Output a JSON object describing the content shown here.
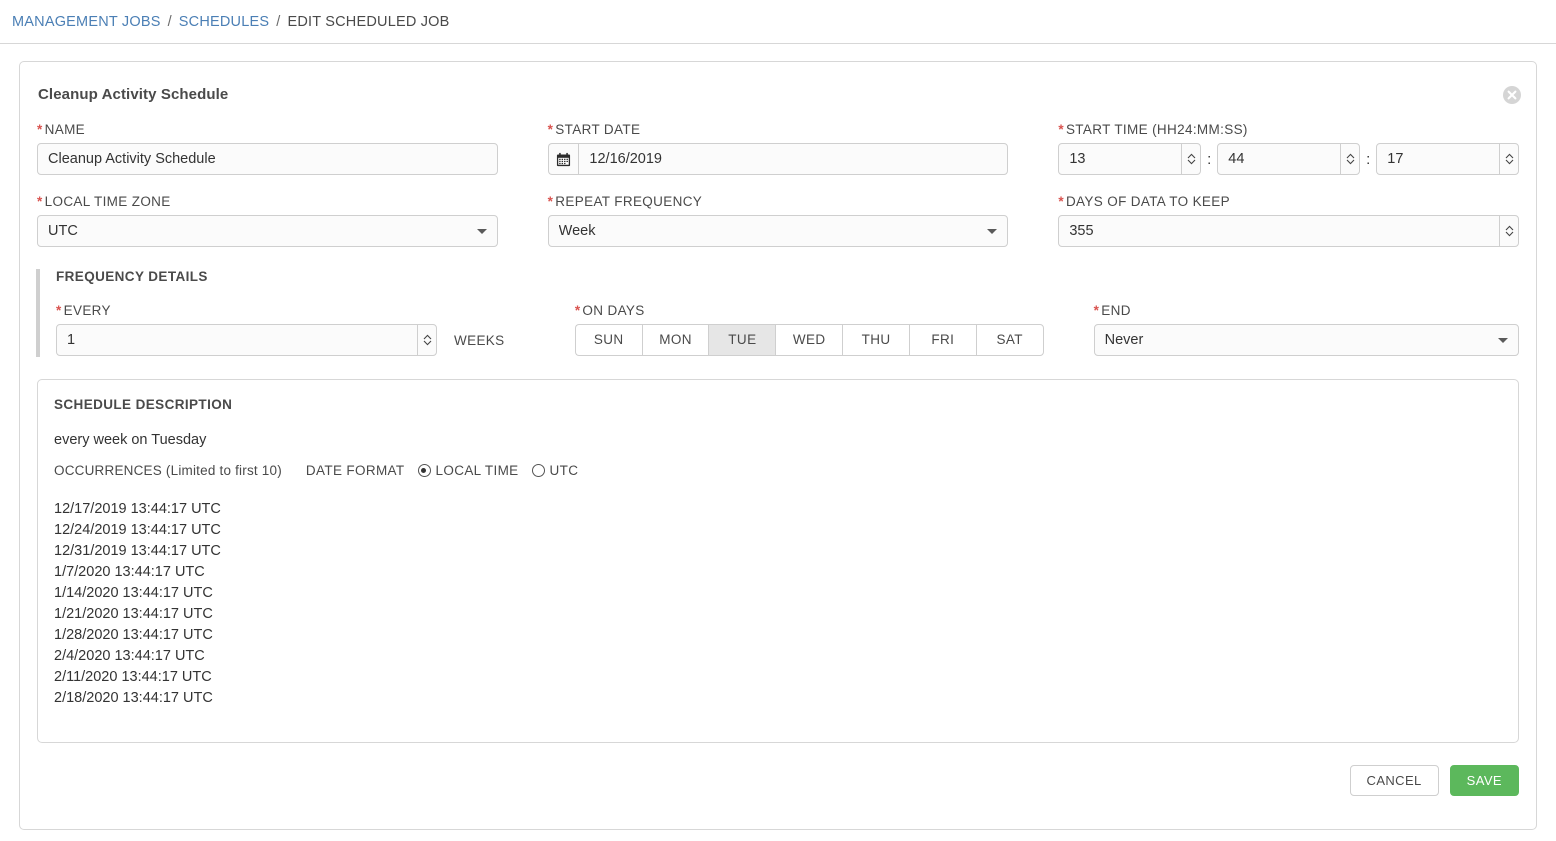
{
  "breadcrumb": {
    "items": [
      {
        "label": "MANAGEMENT JOBS",
        "link": true
      },
      {
        "label": "SCHEDULES",
        "link": true
      },
      {
        "label": "EDIT SCHEDULED JOB",
        "link": false
      }
    ],
    "separator": "/"
  },
  "card": {
    "title": "Cleanup Activity Schedule",
    "close_icon": "close-circle-icon"
  },
  "form": {
    "name": {
      "label": "NAME",
      "required": "*",
      "value": "Cleanup Activity Schedule"
    },
    "start_date": {
      "label": "START DATE",
      "required": "*",
      "value": "12/16/2019",
      "icon": "calendar-icon"
    },
    "start_time": {
      "label": "START TIME (HH24:MM:SS)",
      "required": "*",
      "hours": "13",
      "minutes": "44",
      "seconds": "17",
      "separator": ":"
    },
    "local_time_zone": {
      "label": "LOCAL TIME ZONE",
      "required": "*",
      "value": "UTC"
    },
    "repeat_frequency": {
      "label": "REPEAT FREQUENCY",
      "required": "*",
      "value": "Week"
    },
    "days_of_data_to_keep": {
      "label": "DAYS OF DATA TO KEEP",
      "required": "*",
      "value": "355"
    }
  },
  "frequency_details": {
    "title": "FREQUENCY DETAILS",
    "every": {
      "label": "EVERY",
      "required": "*",
      "value": "1",
      "unit": "WEEKS"
    },
    "on_days": {
      "label": "ON DAYS",
      "required": "*",
      "days": [
        {
          "label": "SUN",
          "selected": false
        },
        {
          "label": "MON",
          "selected": false
        },
        {
          "label": "TUE",
          "selected": true
        },
        {
          "label": "WED",
          "selected": false
        },
        {
          "label": "THU",
          "selected": false
        },
        {
          "label": "FRI",
          "selected": false
        },
        {
          "label": "SAT",
          "selected": false
        }
      ]
    },
    "end": {
      "label": "END",
      "required": "*",
      "value": "Never"
    }
  },
  "schedule_description": {
    "title": "SCHEDULE DESCRIPTION",
    "summary": "every week on Tuesday",
    "occurrences_label": "OCCURRENCES ",
    "occurrences_limit_note": "(Limited to first 10)",
    "date_format_label": "DATE FORMAT",
    "date_format_options": [
      {
        "label": "LOCAL TIME",
        "selected": true
      },
      {
        "label": "UTC",
        "selected": false
      }
    ],
    "occurrences": [
      "12/17/2019 13:44:17 UTC",
      "12/24/2019 13:44:17 UTC",
      "12/31/2019 13:44:17 UTC",
      "1/7/2020 13:44:17 UTC",
      "1/14/2020 13:44:17 UTC",
      "1/21/2020 13:44:17 UTC",
      "1/28/2020 13:44:17 UTC",
      "2/4/2020 13:44:17 UTC",
      "2/11/2020 13:44:17 UTC",
      "2/18/2020 13:44:17 UTC"
    ]
  },
  "footer": {
    "cancel_label": "CANCEL",
    "save_label": "SAVE"
  },
  "colors": {
    "link": "#4b7fb5",
    "required": "#d9534f",
    "save": "#5cb85c",
    "selected_day": "#e6e6e6",
    "border": "#cfcfcf"
  }
}
